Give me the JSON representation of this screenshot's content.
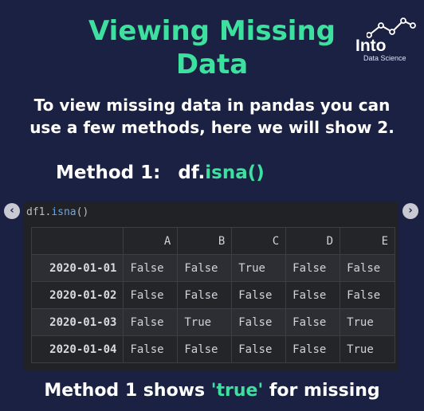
{
  "title_line1": "Viewing Missing",
  "title_line2": "Data",
  "logo": {
    "word": "Into",
    "sub": "Data Science",
    "icon": "line-chart-icon"
  },
  "intro_line1": "To view missing data in pandas you can",
  "intro_line2": "use a few methods, here we will show 2.",
  "method_label": "Method 1:",
  "method_code_prefix": "df.",
  "method_code_fn": "isna()",
  "nav": {
    "left": "‹",
    "right": "›"
  },
  "cell_code": {
    "prefix": "df1.",
    "fn": "isna",
    "suffix": "()"
  },
  "table": {
    "columns": [
      "",
      "A",
      "B",
      "C",
      "D",
      "E"
    ],
    "rows": [
      {
        "index": "2020-01-01",
        "values": [
          "False",
          "False",
          "True",
          "False",
          "False"
        ]
      },
      {
        "index": "2020-01-02",
        "values": [
          "False",
          "False",
          "False",
          "False",
          "False"
        ]
      },
      {
        "index": "2020-01-03",
        "values": [
          "False",
          "True",
          "False",
          "False",
          "True"
        ]
      },
      {
        "index": "2020-01-04",
        "values": [
          "False",
          "False",
          "False",
          "False",
          "True"
        ]
      }
    ]
  },
  "footer_before": "Method 1 shows ",
  "footer_highlight": "'true'",
  "footer_after": " for missing",
  "colors": {
    "background": "#1b2142",
    "accent": "#3ee0a0",
    "notebook": "#202225"
  }
}
